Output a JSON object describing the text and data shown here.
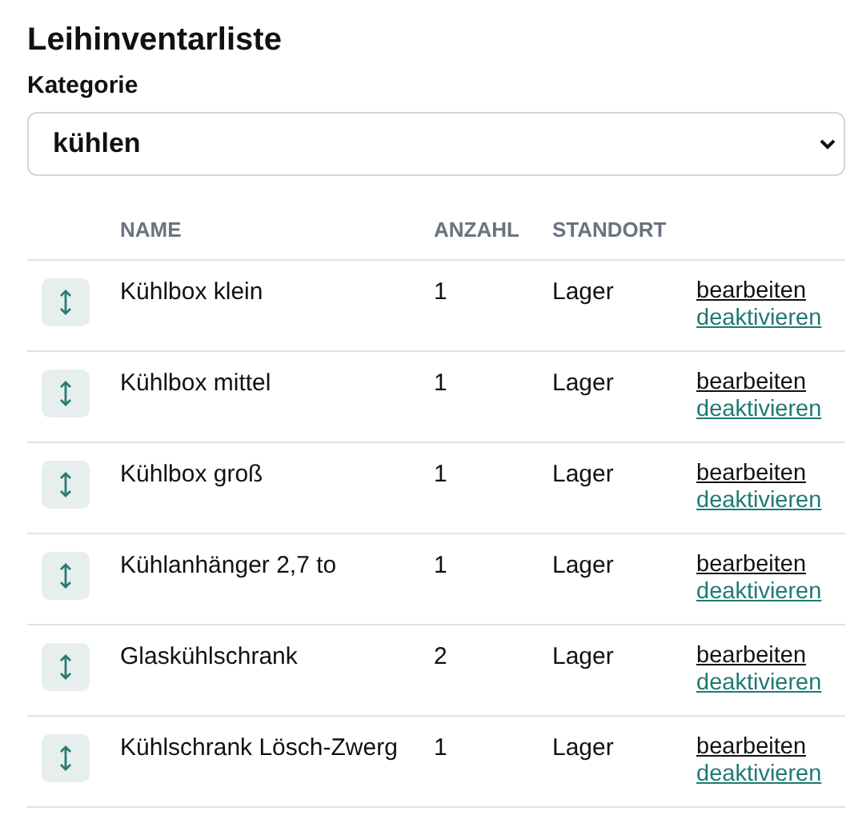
{
  "title": "Leihinventarliste",
  "category": {
    "label": "Kategorie",
    "value": "kühlen"
  },
  "table": {
    "columns": [
      "NAME",
      "ANZAHL",
      "STANDORT"
    ],
    "rows": [
      {
        "name": "Kühlbox klein",
        "count": "1",
        "location": "Lager",
        "actions": [
          "bearbeiten",
          "deaktivieren"
        ]
      },
      {
        "name": "Kühlbox mittel",
        "count": "1",
        "location": "Lager",
        "actions": [
          "bearbeiten",
          "deaktivieren"
        ]
      },
      {
        "name": "Kühlbox groß",
        "count": "1",
        "location": "Lager",
        "actions": [
          "bearbeiten",
          "deaktivieren"
        ]
      },
      {
        "name": "Kühlanhänger 2,7 to",
        "count": "1",
        "location": "Lager",
        "actions": [
          "bearbeiten",
          "deaktivieren"
        ]
      },
      {
        "name": "Glaskühlschrank",
        "count": "2",
        "location": "Lager",
        "actions": [
          "bearbeiten",
          "deaktivieren"
        ]
      },
      {
        "name": "Kühlschrank Lösch-Zwerg",
        "count": "1",
        "location": "Lager",
        "actions": [
          "bearbeiten",
          "deaktivieren"
        ]
      }
    ]
  }
}
